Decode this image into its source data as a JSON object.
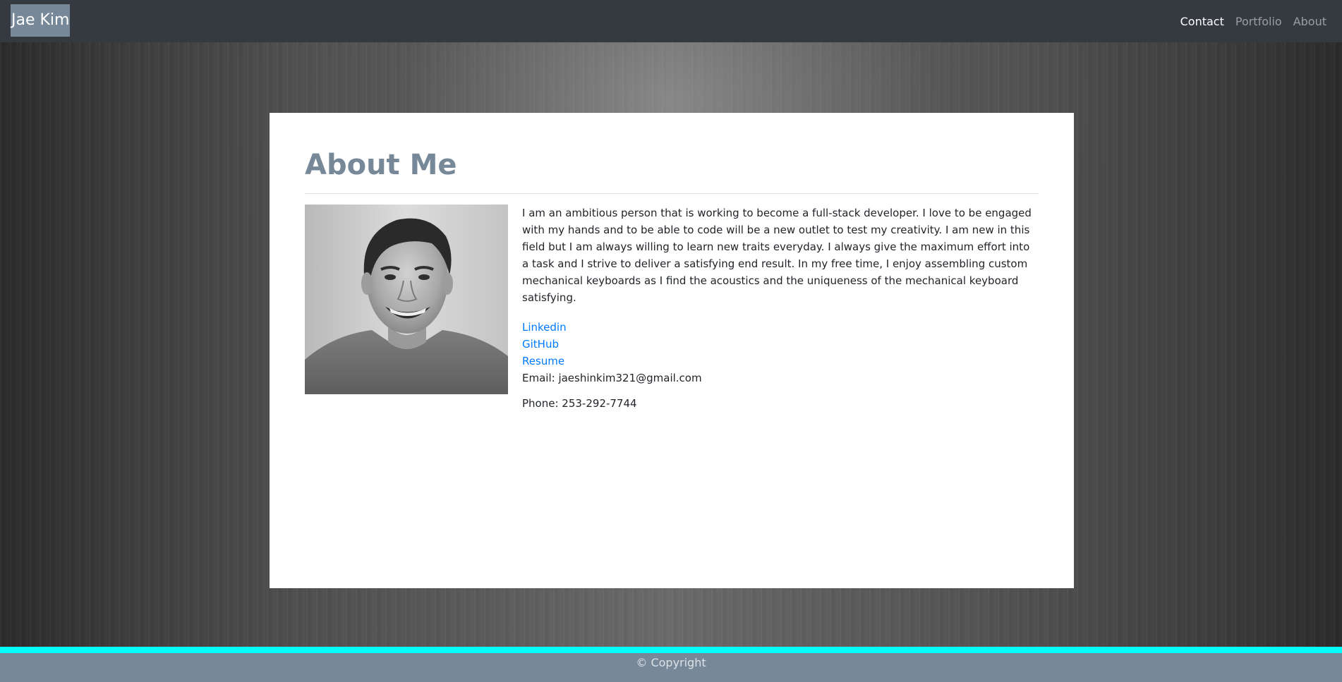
{
  "navbar": {
    "brand": "Jae Kim",
    "links": [
      {
        "label": "Contact",
        "active": true
      },
      {
        "label": "Portfolio",
        "active": false
      },
      {
        "label": "About",
        "active": false
      }
    ]
  },
  "about": {
    "title": "About Me",
    "bio": "I am an ambitious person that is working to become a full-stack developer. I love to be engaged with my hands and to be able to code will be a new outlet to test my creativity. I am new in this field but I am always willing to learn new traits everyday. I always give the maximum effort into a task and I strive to deliver a satisfying end result. In my free time, I enjoy assembling custom mechanical keyboards as I find the acoustics and the uniqueness of the mechanical keyboard satisfying.",
    "links": {
      "linkedin": "Linkedin",
      "github": "GitHub",
      "resume": "Resume"
    },
    "email": "Email: jaeshinkim321@gmail.com",
    "phone": "Phone: 253-292-7744"
  },
  "footer": {
    "copyright": "© Copyright"
  },
  "colors": {
    "navbar_bg": "#343a40",
    "brand_bg": "#778899",
    "title": "#778899",
    "link": "#007bff",
    "footer_accent": "#00ffff",
    "footer_bg": "#778899"
  }
}
